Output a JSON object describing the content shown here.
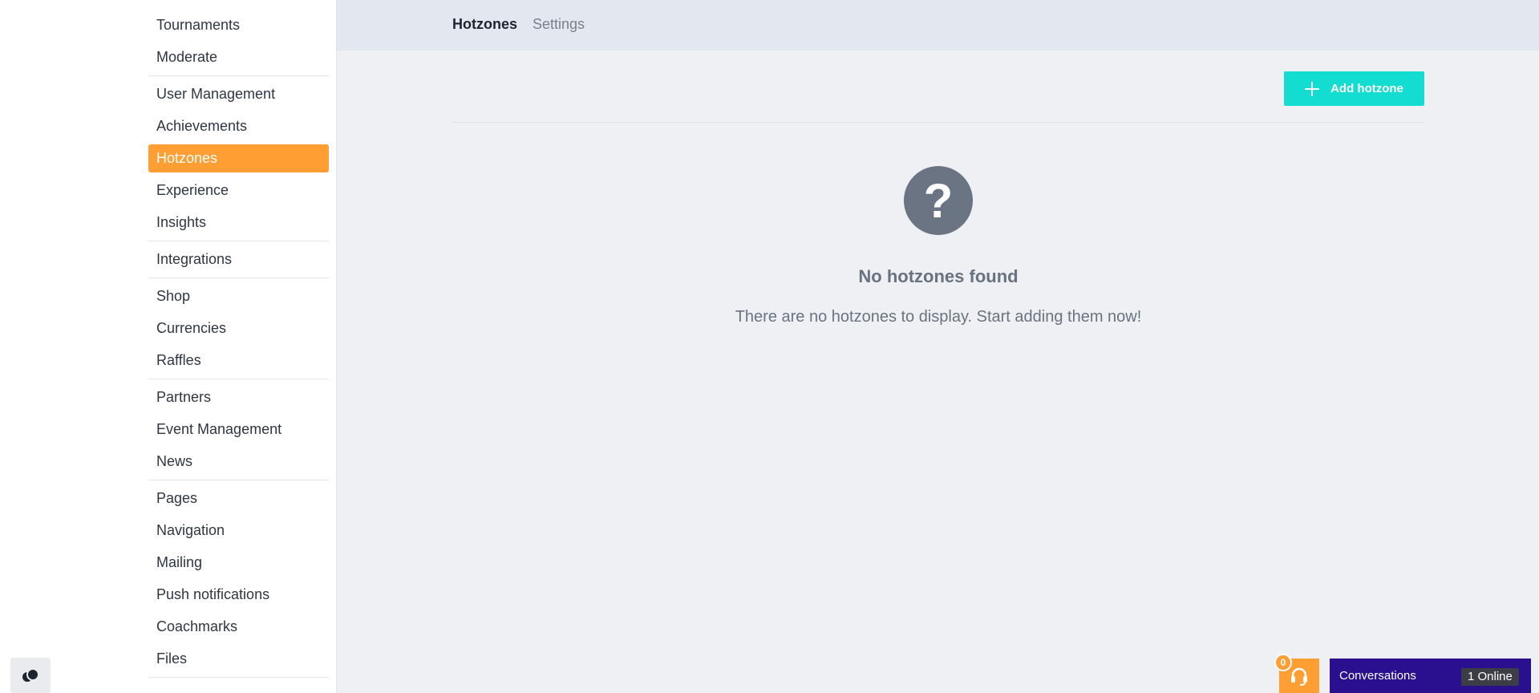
{
  "sidebar": {
    "groups": [
      {
        "items": [
          {
            "label": "Tournaments"
          },
          {
            "label": "Moderate"
          }
        ]
      },
      {
        "items": [
          {
            "label": "User Management"
          },
          {
            "label": "Achievements"
          },
          {
            "label": "Hotzones",
            "active": true
          },
          {
            "label": "Experience"
          },
          {
            "label": "Insights"
          }
        ]
      },
      {
        "items": [
          {
            "label": "Integrations"
          }
        ]
      },
      {
        "items": [
          {
            "label": "Shop"
          },
          {
            "label": "Currencies"
          },
          {
            "label": "Raffles"
          }
        ]
      },
      {
        "items": [
          {
            "label": "Partners"
          },
          {
            "label": "Event Management"
          },
          {
            "label": "News"
          }
        ]
      },
      {
        "items": [
          {
            "label": "Pages"
          },
          {
            "label": "Navigation"
          },
          {
            "label": "Mailing"
          },
          {
            "label": "Push notifications"
          },
          {
            "label": "Coachmarks"
          },
          {
            "label": "Files"
          }
        ]
      }
    ],
    "theme_toggle_icon": "theme-toggle-icon"
  },
  "header": {
    "tabs": [
      {
        "label": "Hotzones",
        "active": true
      },
      {
        "label": "Settings",
        "active": false
      }
    ]
  },
  "main": {
    "add_button_label": "Add hotzone",
    "empty_state": {
      "icon": "question-circle-icon",
      "title": "No hotzones found",
      "text": "There are no hotzones to display. Start adding them now!"
    }
  },
  "chat": {
    "badge_count": "0",
    "conversations_label": "Conversations",
    "online_label": "1 Online"
  },
  "colors": {
    "accent": "#ff9f33",
    "primary_button": "#12ddd0",
    "chat_bar": "#2a0f8f"
  }
}
